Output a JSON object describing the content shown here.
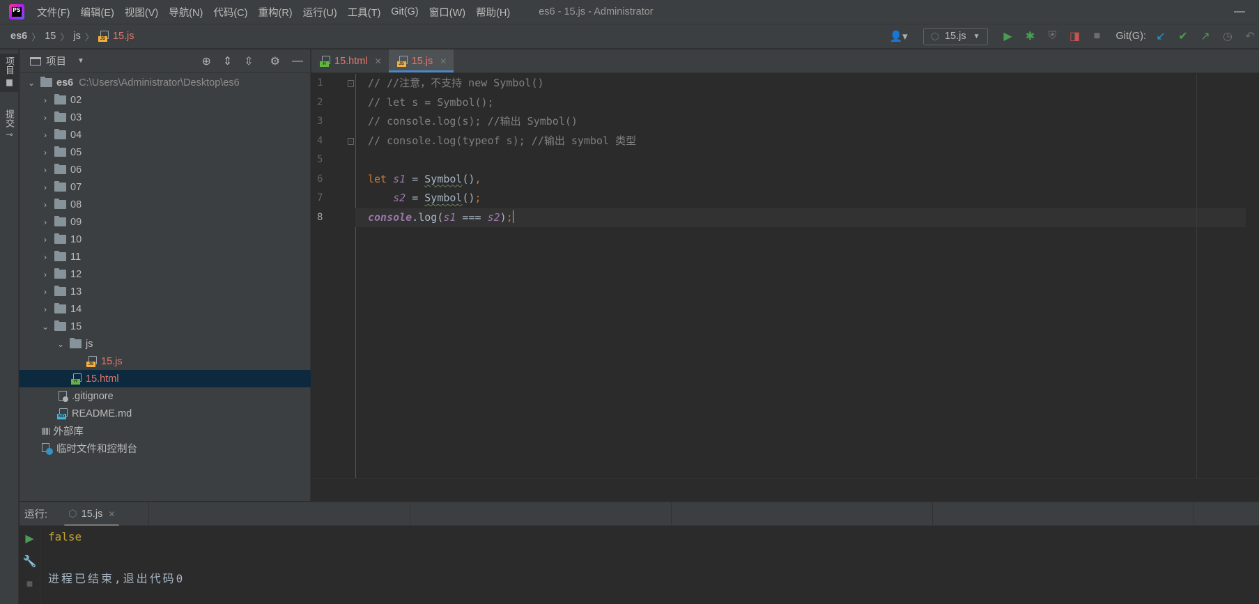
{
  "menubar": {
    "logo_text": "PS",
    "items": [
      {
        "label": "文件(F)"
      },
      {
        "label": "编辑(E)"
      },
      {
        "label": "视图(V)"
      },
      {
        "label": "导航(N)"
      },
      {
        "label": "代码(C)"
      },
      {
        "label": "重构(R)"
      },
      {
        "label": "运行(U)"
      },
      {
        "label": "工具(T)"
      },
      {
        "label": "Git(G)"
      },
      {
        "label": "窗口(W)"
      },
      {
        "label": "帮助(H)"
      }
    ],
    "window_title": "es6 - 15.js - Administrator",
    "minimize_glyph": "—"
  },
  "breadcrumb": {
    "items": [
      "es6",
      "15",
      "js"
    ],
    "current": "15.js",
    "separator": "〉"
  },
  "toolbar": {
    "run_config": "15.js",
    "git_label": "Git(G):"
  },
  "left_stripe": {
    "project": "项目",
    "commit": "提交"
  },
  "project_panel": {
    "title": "项目",
    "root_name": "es6",
    "root_path": "C:\\Users\\Administrator\\Desktop\\es6",
    "folders": [
      "02",
      "03",
      "04",
      "05",
      "06",
      "07",
      "08",
      "09",
      "10",
      "11",
      "12",
      "13",
      "14",
      "15"
    ],
    "sub_folder": "js",
    "js_file": "15.js",
    "html_file": "15.html",
    "gitignore": ".gitignore",
    "readme": "README.md",
    "external_libs": "外部库",
    "scratches": "临时文件和控制台"
  },
  "editor": {
    "tabs": [
      {
        "label": "15.html",
        "active": false
      },
      {
        "label": "15.js",
        "active": true
      }
    ],
    "line_numbers": [
      "1",
      "2",
      "3",
      "4",
      "5",
      "6",
      "7",
      "8"
    ],
    "current_line": 8,
    "lines": {
      "l1": "// //注意，不支持 new Symbol()",
      "l2": "// let s = Symbol();",
      "l3": "// console.log(s); //输出 Symbol()",
      "l4": "// console.log(typeof s); //输出 symbol 类型",
      "l6_kw": "let",
      "l6_var": "s1",
      "l6_eq": " = ",
      "l6_fn": "Symbol",
      "l6_call": "()",
      "l6_comma": ",",
      "l7_indent": "    ",
      "l7_var": "s2",
      "l7_eq": " = ",
      "l7_fn": "Symbol",
      "l7_call": "()",
      "l7_semi": ";",
      "l8_obj": "console",
      "l8_dot_log": ".log(",
      "l8_a": "s1",
      "l8_op": " === ",
      "l8_b": "s2",
      "l8_close": ")",
      "l8_semi": ";"
    }
  },
  "run_panel": {
    "label": "运行:",
    "tab": "15.js",
    "output": "false",
    "exit_message": "进程已结束,退出代码0"
  },
  "colors": {
    "background": "#2b2b2b",
    "panel": "#3c3f41",
    "keyword": "#cc7832",
    "variable": "#9876aa",
    "comment": "#808080",
    "file_modified": "#e2786e",
    "console_output": "#bfa22a",
    "selection": "#0d293e",
    "tab_underline": "#4a88c7"
  }
}
